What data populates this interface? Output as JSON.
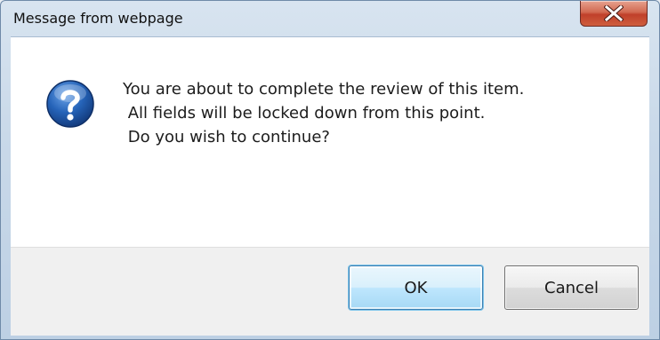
{
  "window": {
    "title": "Message from webpage",
    "close_icon": "close-x-icon"
  },
  "message": {
    "icon": "question-icon",
    "lines": [
      "You are about to complete the review of this item.",
      " All fields will be locked down from this point.",
      " Do you wish to continue?"
    ]
  },
  "buttons": {
    "ok_label": "OK",
    "cancel_label": "Cancel"
  },
  "colors": {
    "close_button": "#c0402a",
    "question_icon": "#2563b8",
    "ok_border": "#3c7fb1"
  }
}
